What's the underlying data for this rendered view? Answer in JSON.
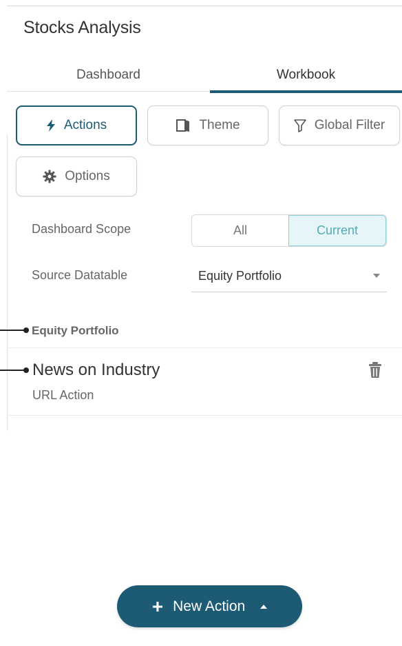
{
  "header": {
    "title": "Stocks Analysis"
  },
  "tabs": [
    {
      "label": "Dashboard",
      "active": false
    },
    {
      "label": "Workbook",
      "active": true
    }
  ],
  "toolbar": {
    "actions_label": "Actions",
    "actions_icon": "lightning-icon",
    "theme_label": "Theme",
    "theme_icon": "theme-book-icon",
    "global_filter_label": "Global Filter",
    "global_filter_icon": "filter-funnel-icon",
    "options_label": "Options",
    "options_icon": "gear-icon"
  },
  "settings": {
    "scope_label": "Dashboard Scope",
    "scope_options": [
      "All",
      "Current"
    ],
    "scope_selected": "Current",
    "source_label": "Source Datatable",
    "source_value": "Equity Portfolio"
  },
  "actions_list": {
    "group_name": "Equity Portfolio",
    "items": [
      {
        "name": "News on Industry",
        "type": "URL Action",
        "delete_icon": "trash-icon"
      }
    ]
  },
  "footer": {
    "new_action_label": "New Action"
  },
  "colors": {
    "accent": "#1c5b73",
    "selected_segment_bg": "#e6f6f8",
    "selected_segment_text": "#55a9b6"
  }
}
